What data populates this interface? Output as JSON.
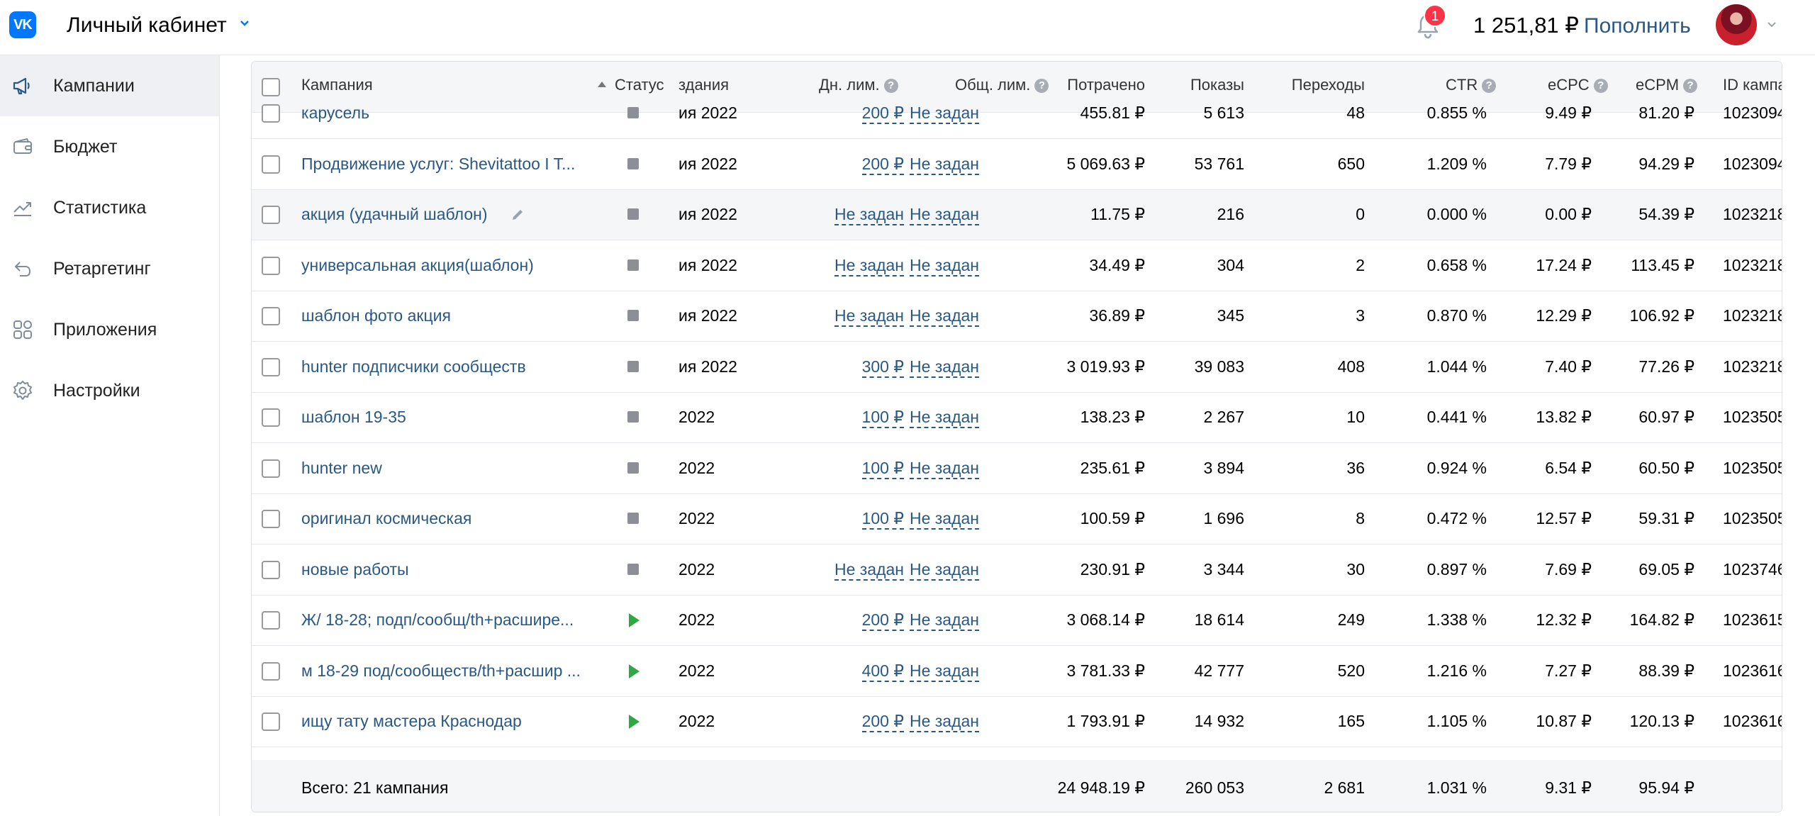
{
  "header": {
    "logo": "VK",
    "cabinet_title": "Личный кабинет",
    "notifications_count": "1",
    "balance": "1 251,81 ₽",
    "topup_label": "Пополнить"
  },
  "sidebar": {
    "items": [
      {
        "label": "Кампании",
        "icon": "megaphone-icon",
        "active": true
      },
      {
        "label": "Бюджет",
        "icon": "wallet-icon"
      },
      {
        "label": "Статистика",
        "icon": "chart-icon"
      },
      {
        "label": "Ретаргетинг",
        "icon": "retarget-icon"
      },
      {
        "label": "Приложения",
        "icon": "apps-icon"
      },
      {
        "label": "Настройки",
        "icon": "gear-icon"
      }
    ]
  },
  "table": {
    "columns": {
      "campaign": "Кампания",
      "status": "Статус",
      "created": "здания",
      "day_limit": "Дн. лим.",
      "total_limit": "Общ. лим.",
      "spent": "Потрачено",
      "impressions": "Показы",
      "clicks": "Переходы",
      "ctr": "CTR",
      "ecpc": "eCPC",
      "ecpm": "eCPM",
      "id": "ID кампа"
    },
    "rows": [
      {
        "name": "карусель",
        "status": "stopped",
        "created": "ия 2022",
        "day_limit": "200 ₽",
        "total_limit": "Не задан",
        "spent": "455.81 ₽",
        "impressions": "5 613",
        "clicks": "48",
        "ctr": "0.855 %",
        "ecpc": "9.49 ₽",
        "ecpm": "81.20 ₽",
        "id": "1023094"
      },
      {
        "name": "Продвижение услуг: Shevitattoo I T...",
        "status": "stopped",
        "created": "ия 2022",
        "day_limit": "200 ₽",
        "total_limit": "Не задан",
        "spent": "5 069.63 ₽",
        "impressions": "53 761",
        "clicks": "650",
        "ctr": "1.209 %",
        "ecpc": "7.79 ₽",
        "ecpm": "94.29 ₽",
        "id": "1023094"
      },
      {
        "name": "акция (удачный шаблон)",
        "status": "stopped",
        "created": "ия 2022",
        "day_limit": "Не задан",
        "total_limit": "Не задан",
        "spent": "11.75 ₽",
        "impressions": "216",
        "clicks": "0",
        "ctr": "0.000 %",
        "ecpc": "0.00 ₽",
        "ecpm": "54.39 ₽",
        "id": "1023218"
      },
      {
        "name": "универсальная акция(шаблон)",
        "status": "stopped",
        "created": "ия 2022",
        "day_limit": "Не задан",
        "total_limit": "Не задан",
        "spent": "34.49 ₽",
        "impressions": "304",
        "clicks": "2",
        "ctr": "0.658 %",
        "ecpc": "17.24 ₽",
        "ecpm": "113.45 ₽",
        "id": "1023218"
      },
      {
        "name": "шаблон фото акция",
        "status": "stopped",
        "created": "ия 2022",
        "day_limit": "Не задан",
        "total_limit": "Не задан",
        "spent": "36.89 ₽",
        "impressions": "345",
        "clicks": "3",
        "ctr": "0.870 %",
        "ecpc": "12.29 ₽",
        "ecpm": "106.92 ₽",
        "id": "1023218"
      },
      {
        "name": "hunter подписчики сообществ",
        "status": "stopped",
        "created": "ия 2022",
        "day_limit": "300 ₽",
        "total_limit": "Не задан",
        "spent": "3 019.93 ₽",
        "impressions": "39 083",
        "clicks": "408",
        "ctr": "1.044 %",
        "ecpc": "7.40 ₽",
        "ecpm": "77.26 ₽",
        "id": "1023218"
      },
      {
        "name": "шаблон 19-35",
        "status": "stopped",
        "created": "2022",
        "day_limit": "100 ₽",
        "total_limit": "Не задан",
        "spent": "138.23 ₽",
        "impressions": "2 267",
        "clicks": "10",
        "ctr": "0.441 %",
        "ecpc": "13.82 ₽",
        "ecpm": "60.97 ₽",
        "id": "1023505"
      },
      {
        "name": "hunter new",
        "status": "stopped",
        "created": "2022",
        "day_limit": "100 ₽",
        "total_limit": "Не задан",
        "spent": "235.61 ₽",
        "impressions": "3 894",
        "clicks": "36",
        "ctr": "0.924 %",
        "ecpc": "6.54 ₽",
        "ecpm": "60.50 ₽",
        "id": "1023505"
      },
      {
        "name": "оригинал космическая",
        "status": "stopped",
        "created": "2022",
        "day_limit": "100 ₽",
        "total_limit": "Не задан",
        "spent": "100.59 ₽",
        "impressions": "1 696",
        "clicks": "8",
        "ctr": "0.472 %",
        "ecpc": "12.57 ₽",
        "ecpm": "59.31 ₽",
        "id": "1023505"
      },
      {
        "name": "новые работы",
        "status": "stopped",
        "created": "2022",
        "day_limit": "Не задан",
        "total_limit": "Не задан",
        "spent": "230.91 ₽",
        "impressions": "3 344",
        "clicks": "30",
        "ctr": "0.897 %",
        "ecpc": "7.69 ₽",
        "ecpm": "69.05 ₽",
        "id": "1023746"
      },
      {
        "name": "Ж/ 18-28; подп/сообщ/th+расшире...",
        "status": "running",
        "created": "2022",
        "day_limit": "200 ₽",
        "total_limit": "Не задан",
        "spent": "3 068.14 ₽",
        "impressions": "18 614",
        "clicks": "249",
        "ctr": "1.338 %",
        "ecpc": "12.32 ₽",
        "ecpm": "164.82 ₽",
        "id": "1023615"
      },
      {
        "name": "м 18-29 под/сообществ/th+расшир ...",
        "status": "running",
        "created": "2022",
        "day_limit": "400 ₽",
        "total_limit": "Не задан",
        "spent": "3 781.33 ₽",
        "impressions": "42 777",
        "clicks": "520",
        "ctr": "1.216 %",
        "ecpc": "7.27 ₽",
        "ecpm": "88.39 ₽",
        "id": "1023616"
      },
      {
        "name": "ищу тату мастера Краснодар",
        "status": "running",
        "created": "2022",
        "day_limit": "200 ₽",
        "total_limit": "Не задан",
        "spent": "1 793.91 ₽",
        "impressions": "14 932",
        "clicks": "165",
        "ctr": "1.105 %",
        "ecpc": "10.87 ₽",
        "ecpm": "120.13 ₽",
        "id": "1023616"
      }
    ],
    "footer": {
      "label": "Всего: 21 кампания",
      "spent": "24 948.19 ₽",
      "impressions": "260 053",
      "clicks": "2 681",
      "ctr": "1.031 %",
      "ecpc": "9.31 ₽",
      "ecpm": "95.94 ₽"
    }
  },
  "colors": {
    "link": "#2a5885",
    "brand": "#0077ff",
    "running": "#2da842",
    "stopped": "#8c9096",
    "badge": "#ff3347"
  }
}
